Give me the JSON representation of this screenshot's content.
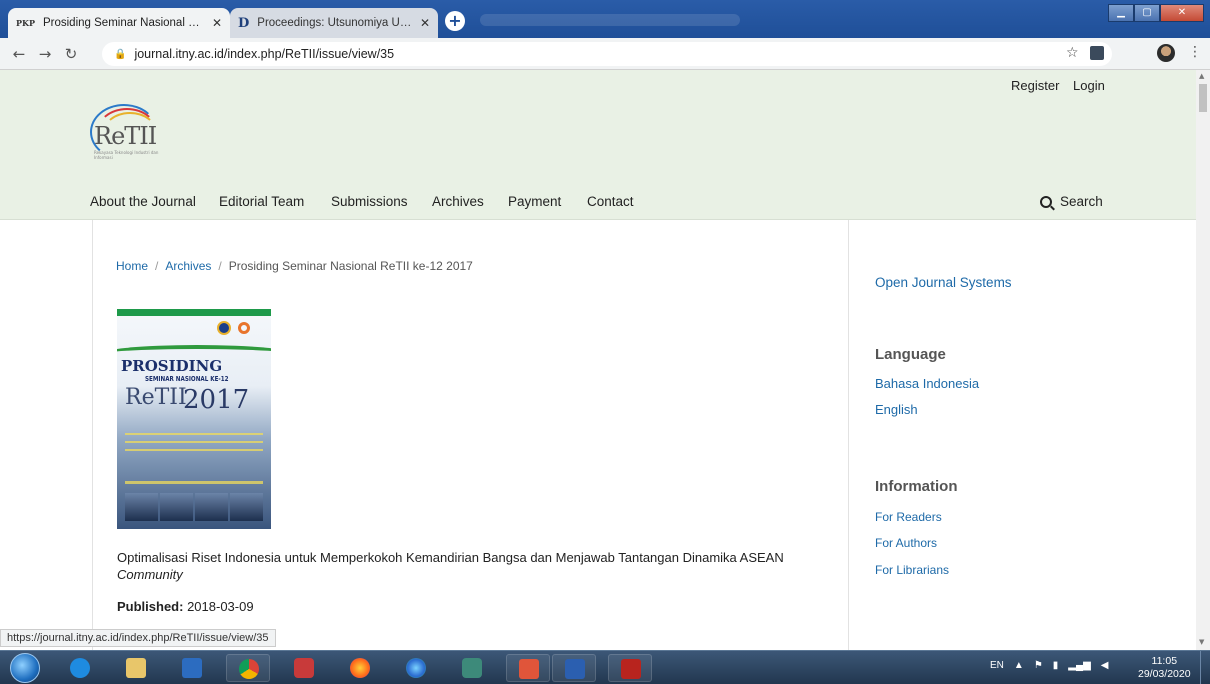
{
  "browser": {
    "tabs": [
      {
        "favicon": "PKP",
        "title": "Prosiding Seminar Nasional ReTII",
        "active": true
      },
      {
        "favicon": "D",
        "title": "Proceedings: Utsunomiya Univer",
        "active": false
      }
    ],
    "new_tab": "+",
    "url": "journal.itny.ac.id/index.php/ReTII/issue/view/35",
    "status_url": "https://journal.itny.ac.id/index.php/ReTII/issue/view/35"
  },
  "header": {
    "register": "Register",
    "login": "Login",
    "logo_text": "ReTII",
    "logo_sub": "Rekayasa Teknologi Industri dan Informasi",
    "nav": [
      "About the Journal",
      "Editorial Team",
      "Submissions",
      "Archives",
      "Payment",
      "Contact"
    ],
    "search_label": "Search"
  },
  "breadcrumb": {
    "home": "Home",
    "archives": "Archives",
    "current": "Prosiding Seminar Nasional ReTII ke-12 2017"
  },
  "cover": {
    "title": "PROSIDING",
    "subtitle": "SEMINAR NASIONAL KE-12",
    "brand": "ReTII",
    "year": "2017"
  },
  "issue": {
    "description": "Optimalisasi Riset Indonesia untuk Memperkokoh Kemandirian Bangsa dan Menjawab Tantangan Dinamika ASEAN",
    "description_em": "Community",
    "published_label": "Published:",
    "published_date": "2018-03-09"
  },
  "sidebar": {
    "ojs": "Open Journal Systems",
    "language_heading": "Language",
    "languages": [
      "Bahasa Indonesia",
      "English"
    ],
    "information_heading": "Information",
    "information": [
      "For Readers",
      "For Authors",
      "For Librarians"
    ]
  },
  "taskbar": {
    "language": "EN",
    "time": "11:05",
    "date": "29/03/2020"
  },
  "colors": {
    "link": "#1e6aa8",
    "header_bg": "#e9f1e5"
  }
}
